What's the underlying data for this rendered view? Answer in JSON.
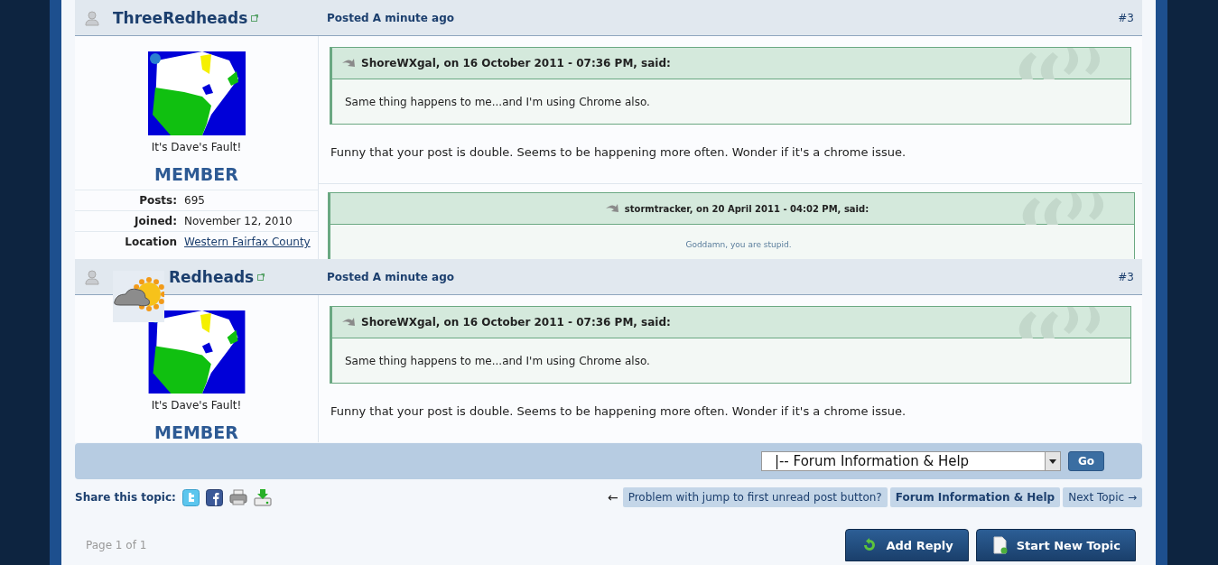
{
  "posts": [
    {
      "author": "ThreeRedheads",
      "posted": "Posted A minute ago",
      "number": "#3",
      "caption": "It's Dave's Fault!",
      "group": "MEMBER",
      "overlay_icon": false,
      "stats": [
        {
          "label": "Posts:",
          "value": "695",
          "kind": "text"
        },
        {
          "label": "Joined:",
          "value": "November 12, 2010",
          "kind": "text"
        },
        {
          "label": "Location",
          "value": "Western Fairfax County",
          "kind": "link"
        }
      ],
      "quote": {
        "cite": "ShoreWXgal, on 16 October 2011 - 07:36 PM, said:",
        "text": "Same thing happens to me...and I'm using Chrome also."
      },
      "text": "Funny that your post is double. Seems to be happening more often. Wonder if it's a chrome issue.",
      "signature": {
        "cite": "stormtracker, on 20 April 2011 - 04:02 PM, said:",
        "text": "Goddamn, you are stupid."
      }
    },
    {
      "author": "Redheads",
      "posted": "Posted A minute ago",
      "number": "#3",
      "caption": "It's Dave's Fault!",
      "group": "MEMBER",
      "overlay_icon": true,
      "quote": {
        "cite": "ShoreWXgal, on 16 October 2011 - 07:36 PM, said:",
        "text": "Same thing happens to me...and I'm using Chrome also."
      },
      "text": "Funny that your post is double. Seems to be happening more often. Wonder if it's a chrome issue."
    }
  ],
  "jump": {
    "value": "|-- Forum Information & Help",
    "button": "Go"
  },
  "share": {
    "label": "Share this topic:"
  },
  "nav": {
    "arrow": "←",
    "links": [
      {
        "label": "Problem with jump to first unread post button?",
        "kind": "topic"
      },
      {
        "label": "Forum Information & Help",
        "kind": "forum"
      },
      {
        "label": "Next Topic →",
        "kind": "topic"
      }
    ]
  },
  "pagination": "Page 1 of 1",
  "buttons": [
    {
      "label": "Add Reply",
      "kind": "reply"
    },
    {
      "label": "Start New Topic",
      "kind": "new"
    }
  ]
}
